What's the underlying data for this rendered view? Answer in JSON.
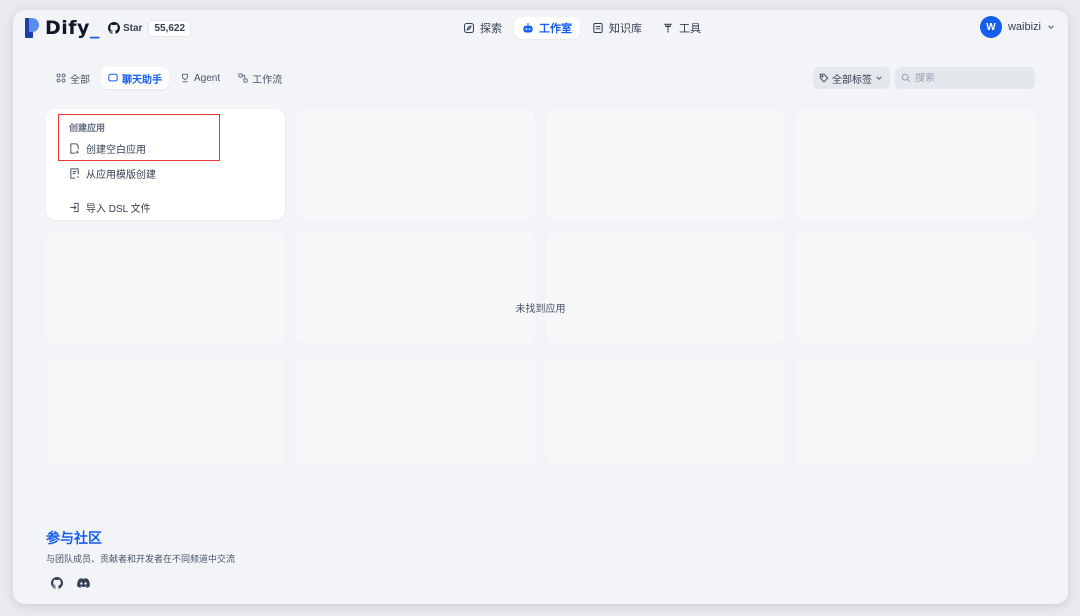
{
  "brand": {
    "name": "Dify",
    "cursor": "_"
  },
  "github": {
    "star_label": "Star",
    "count": "55,622"
  },
  "nav": [
    {
      "label": "探索",
      "icon": "compass-icon",
      "active": false
    },
    {
      "label": "工作室",
      "icon": "robot-icon",
      "active": true
    },
    {
      "label": "知识库",
      "icon": "book-icon",
      "active": false
    },
    {
      "label": "工具",
      "icon": "hammer-icon",
      "active": false
    }
  ],
  "user": {
    "initial": "W",
    "name": "waibizi"
  },
  "tabs": [
    {
      "label": "全部",
      "icon": "grid-icon",
      "active": false
    },
    {
      "label": "聊天助手",
      "icon": "chat-icon",
      "active": true
    },
    {
      "label": "Agent",
      "icon": "agent-icon",
      "active": false
    },
    {
      "label": "工作流",
      "icon": "workflow-icon",
      "active": false
    }
  ],
  "tag_filter": {
    "label": "全部标签"
  },
  "search": {
    "placeholder": "搜索"
  },
  "create_card": {
    "title": "创建应用",
    "items": [
      {
        "label": "创建空白应用",
        "icon": "file-plus-icon"
      },
      {
        "label": "从应用模版创建",
        "icon": "template-icon"
      },
      {
        "label": "导入 DSL 文件",
        "icon": "import-icon"
      }
    ]
  },
  "empty_text": "未找到应用",
  "community": {
    "title": "参与社区",
    "subtitle": "与团队成员、贡献者和开发者在不同频道中交流"
  },
  "colors": {
    "accent": "#155eef",
    "highlight": "#e53935",
    "background": "#f2f4f7"
  }
}
